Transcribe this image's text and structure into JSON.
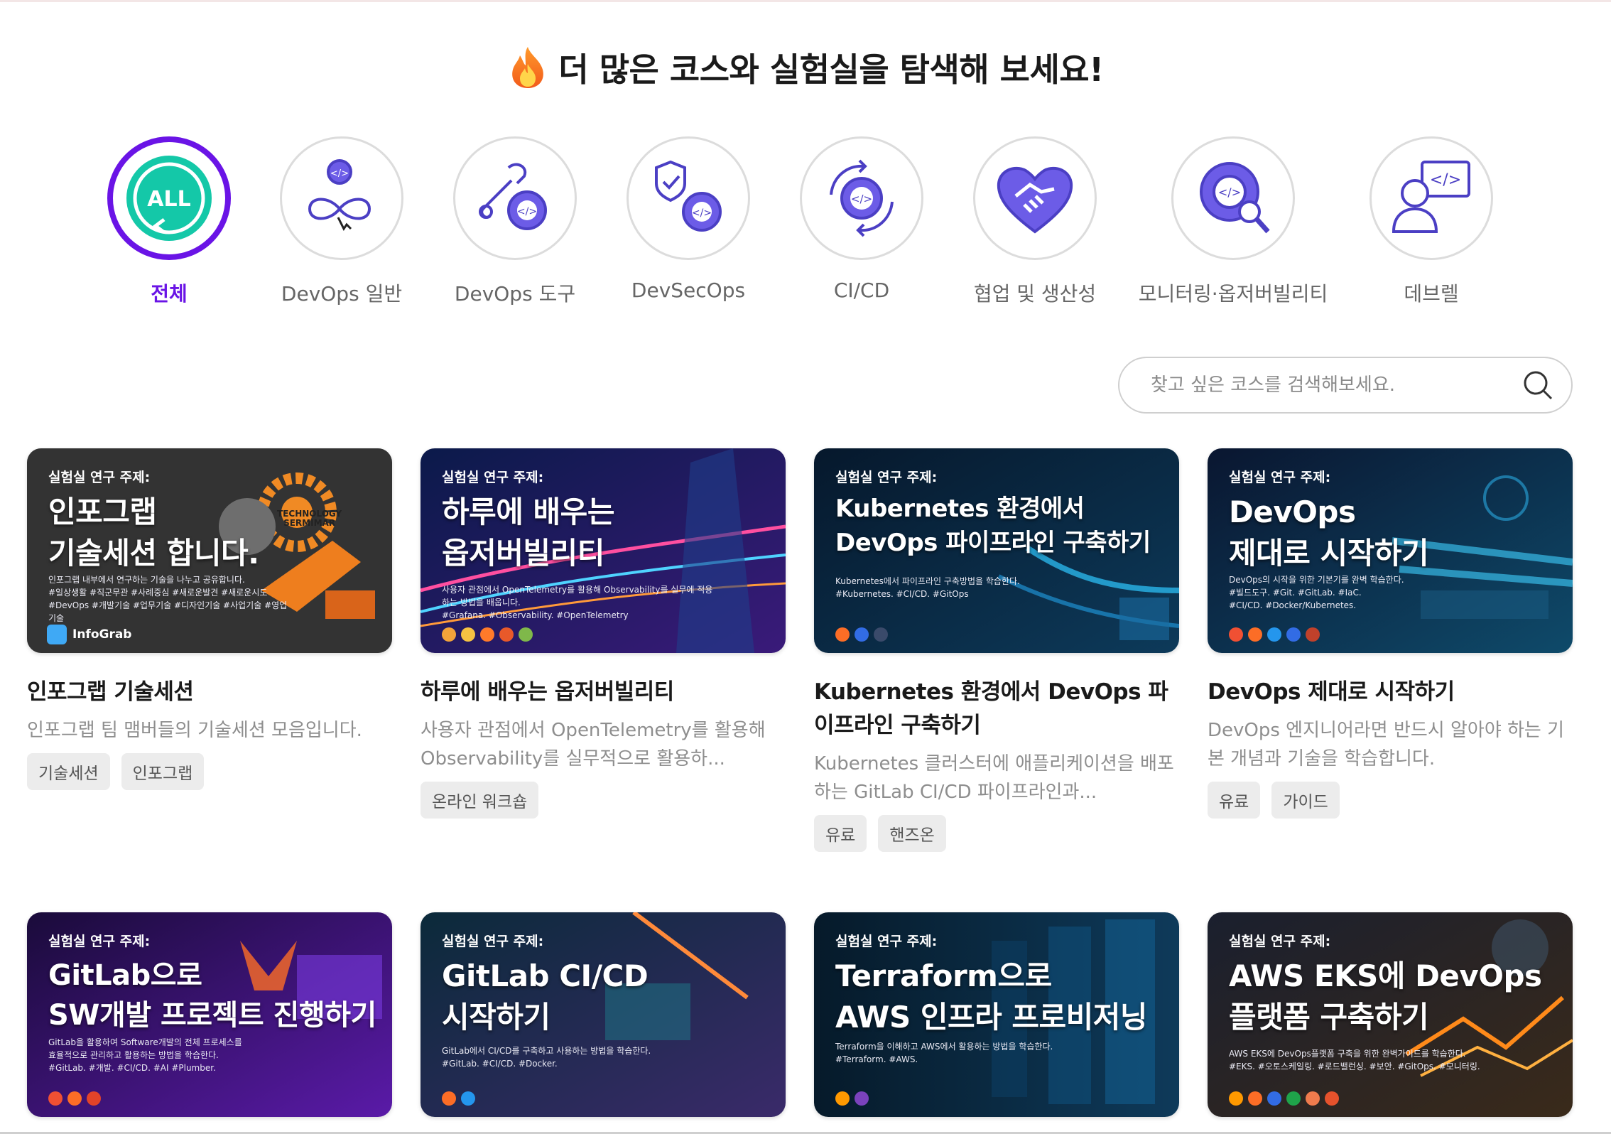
{
  "heading": {
    "title": "더 많은 코스와 실험실을 탐색해 보세요!",
    "icon": "fire-icon"
  },
  "categories": [
    {
      "label": "전체",
      "icon": "all-icon",
      "active": true
    },
    {
      "label": "DevOps 일반",
      "icon": "devops-infinity-icon"
    },
    {
      "label": "DevOps 도구",
      "icon": "wrench-gear-icon"
    },
    {
      "label": "DevSecOps",
      "icon": "shield-gear-icon"
    },
    {
      "label": "CI/CD",
      "icon": "cicd-cycle-icon"
    },
    {
      "label": "협업 및 생산성",
      "icon": "handshake-heart-icon"
    },
    {
      "label": "모니터링·옵저버빌리티",
      "icon": "gear-magnifier-icon"
    },
    {
      "label": "데브렐",
      "icon": "person-code-icon"
    }
  ],
  "search": {
    "placeholder": "찾고 싶은 코스를 검색해보세요."
  },
  "colors": {
    "accent": "#6a14e6",
    "all_icon": "#14c8a8",
    "icon_stroke": "#5b4bd6"
  },
  "cards": [
    {
      "thumb": {
        "eyebrow": "실험실 연구 주제:",
        "title": "인포그랩\n기술세션 합니다.",
        "desc": "인포그랩 내부에서 연구하는 기술을 나누고 공유합니다.\n#일상생활 #직군무관 #사례중심 #새로운발견 #새로운시도\n#DevOps #개발기술 #업무기술 #디자인기술 #사업기술 #영업기술",
        "brand": "InfoGrab",
        "side_text": "TECHNOLOGY\nSERMIMAR"
      },
      "title": "인포그랩 기술세션",
      "desc": "인포그랩 팀 맴버들의 기술세션 모음입니다.",
      "tags": [
        "기술세션",
        "인포그랩"
      ]
    },
    {
      "thumb": {
        "eyebrow": "실험실 연구 주제:",
        "title": "하루에 배우는\n옵저버빌리티",
        "desc": "사용자 관점에서 OpenTelemetry를 활용해 Observability를 실무에 적용\n하는 방법을 배웁니다.\n#Grafana. #Observability. #OpenTelemetry"
      },
      "title": "하루에 배우는 옵저버빌리티",
      "desc": "사용자 관점에서 OpenTelemetry를 활용해 Observability를 실무적으로 활용하...",
      "tags": [
        "온라인 워크숍"
      ]
    },
    {
      "thumb": {
        "eyebrow": "실험실 연구 주제:",
        "title": "Kubernetes 환경에서\nDevOps 파이프라인 구축하기",
        "desc": "Kubernetes에서 파이프라인 구축방법을 학습한다.\n#Kubernetes. #CI/CD. #GitOps"
      },
      "title": "Kubernetes 환경에서 DevOps 파이프라인 구축하기",
      "desc": "Kubernetes 클러스터에 애플리케이션을 배포하는 GitLab CI/CD 파이프라인과...",
      "tags": [
        "유료",
        "핸즈온"
      ]
    },
    {
      "thumb": {
        "eyebrow": "실험실 연구 주제:",
        "title": "DevOps\n제대로 시작하기",
        "desc": "DevOps의 시작을 위한 기본기를 완벽 학습한다.\n#빌드도구. #Git. #GitLab. #IaC.\n#CI/CD. #Docker/Kubernetes."
      },
      "title": "DevOps 제대로 시작하기",
      "desc": "DevOps 엔지니어라면 반드시 알아야 하는 기본 개념과 기술을 학습합니다.",
      "tags": [
        "유료",
        "가이드"
      ]
    },
    {
      "thumb": {
        "eyebrow": "실험실 연구 주제:",
        "title": "GitLab으로\nSW개발 프로젝트 진행하기",
        "desc": "GitLab을 활용하여 Software개발의 전체 프로세스를\n효율적으로 관리하고 활용하는 방법을 학습한다.\n#GitLab. #개발. #CI/CD. #AI #Plumber."
      }
    },
    {
      "thumb": {
        "eyebrow": "실험실 연구 주제:",
        "title": "GitLab CI/CD\n시작하기",
        "desc": "GitLab에서 CI/CD를 구축하고 사용하는 방법을 학습한다.\n#GitLab. #CI/CD. #Docker."
      }
    },
    {
      "thumb": {
        "eyebrow": "실험실 연구 주제:",
        "title": "Terraform으로\nAWS 인프라 프로비저닝",
        "desc": "Terraform을 이해하고 AWS에서 활용하는 방법을 학습한다.\n#Terraform. #AWS."
      }
    },
    {
      "thumb": {
        "eyebrow": "실험실 연구 주제:",
        "title": "AWS EKS에 DevOps\n플랫폼 구축하기",
        "desc": "AWS EKS에 DevOps플랫폼 구축을 위한 완벽가이드를 학습한다.\n#EKS. #오토스케일링. #로드밸런싱. #보안. #GitOps. #모니터링."
      }
    }
  ]
}
